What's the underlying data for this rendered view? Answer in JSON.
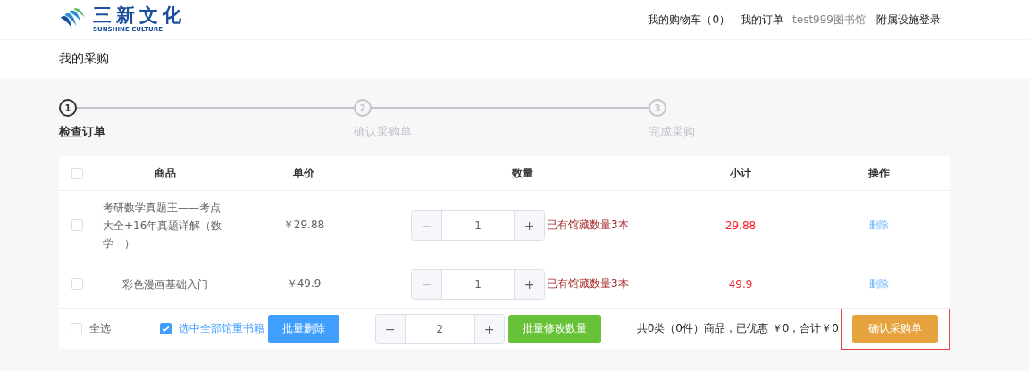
{
  "logo": {
    "name": "三新文化",
    "tagline": "SUNSHINE CULTURE"
  },
  "nav": [
    {
      "label": "我的购物车（0）",
      "kind": "link"
    },
    {
      "label": "我的订单",
      "kind": "link"
    },
    {
      "label": "test999图书馆",
      "kind": "user"
    },
    {
      "label": "附属设施登录",
      "kind": "link"
    }
  ],
  "page_title": "我的采购",
  "steps": [
    {
      "number": "1",
      "label": "检查订单",
      "selected": true
    },
    {
      "number": "2",
      "label": "确认采购单",
      "selected": false
    },
    {
      "number": "3",
      "label": "完成采购",
      "selected": false
    }
  ],
  "table": {
    "header_checked": false,
    "columns": [
      "商品",
      "单价",
      "数量",
      "小计",
      "操作"
    ],
    "rows": [
      {
        "checked": false,
        "title": "考研数学真题王——考点大全+16年真题详解（数学一）",
        "price": "￥29.88",
        "quantity": "1",
        "minus": "−",
        "plus": "+",
        "note": "已有馆藏数量3本",
        "subtotal": "29.88",
        "action": "删除"
      },
      {
        "checked": false,
        "title": "彩色漫画基础入门",
        "price": "￥49.9",
        "quantity": "1",
        "minus": "−",
        "plus": "+",
        "note": "已有馆藏数量3本",
        "subtotal": "49.9",
        "action": "删除"
      }
    ]
  },
  "footer": {
    "select_all": {
      "label": "全选",
      "checked": false
    },
    "select_key": {
      "label": "选中全部馆重书籍",
      "checked": true
    },
    "batch_delete": "批量删除",
    "quantity": "2",
    "minus": "−",
    "plus": "+",
    "batch_edit": "批量修改数量",
    "summary": "共0类（0件）商品，已优惠 ￥0，合计￥0",
    "confirm": "确认采购单",
    "confirm_highlighted": true
  }
}
